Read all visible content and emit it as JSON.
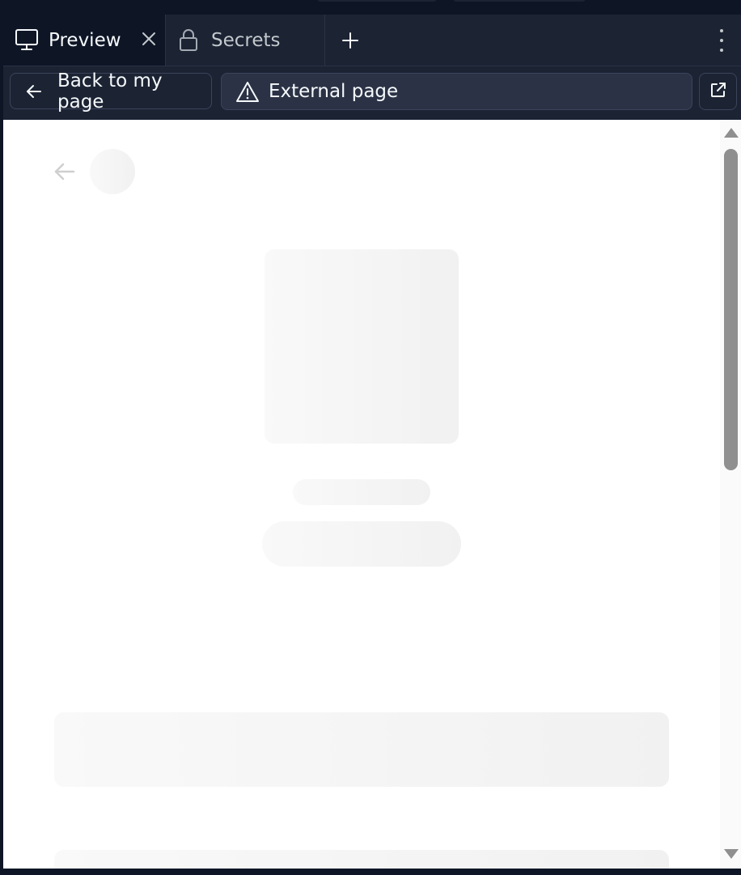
{
  "tabs": [
    {
      "label": "Preview",
      "icon": "monitor-icon",
      "active": true,
      "closable": true
    },
    {
      "label": "Secrets",
      "icon": "lock-icon",
      "active": false,
      "closable": false
    }
  ],
  "tabbar": {
    "add_tab_icon": "plus-icon",
    "menu_icon": "kebab-menu-icon"
  },
  "addressbar": {
    "back_label": "Back to my page",
    "url_label": "External page",
    "url_icon": "warning-icon",
    "open_external_icon": "external-link-icon"
  },
  "webview": {
    "state": "loading-skeleton",
    "back_icon": "arrow-left-icon"
  },
  "colors": {
    "chrome_bg": "#0e1525",
    "bar_bg": "#1c2333",
    "border": "#3c445c",
    "field_bg": "#2b3245",
    "text": "#f5f9fc",
    "muted_text": "#c2c8cc",
    "skeleton": "#f3f3f3",
    "scroll_thumb": "#8f8f8f"
  }
}
